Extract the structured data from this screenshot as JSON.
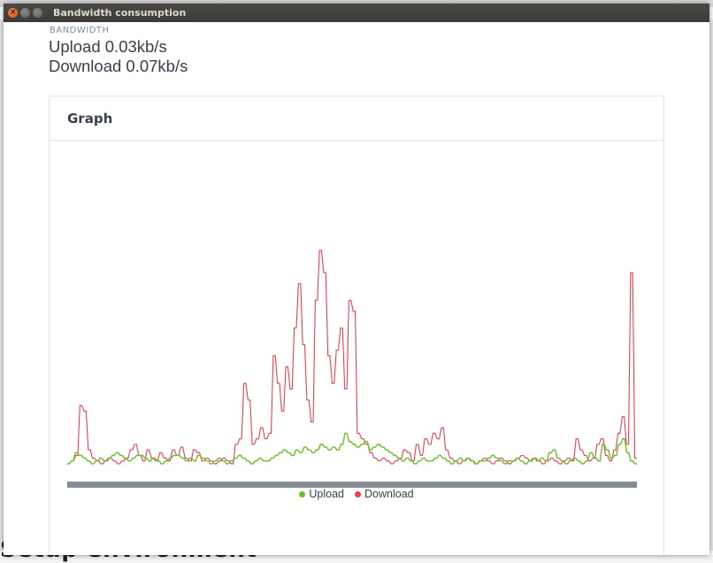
{
  "window": {
    "title": "Bandwidth consumption"
  },
  "header": {
    "kicker": "BANDWIDTH",
    "upload_text": "Upload 0.03kb/s",
    "download_text": "Download 0.07kb/s"
  },
  "card": {
    "title": "Graph"
  },
  "background": {
    "partial_heading": "Setup environment"
  },
  "chart_data": {
    "type": "line",
    "title": "",
    "xlabel": "",
    "ylabel": "",
    "ylim": [
      0,
      100
    ],
    "grid": false,
    "legend_position": "bottom",
    "series": [
      {
        "name": "Upload",
        "color": "#6abf2a",
        "values": [
          1,
          1,
          2,
          2,
          5,
          5,
          4,
          4,
          3,
          3,
          2,
          2,
          1,
          1,
          2,
          2,
          3,
          3,
          2,
          2,
          3,
          3,
          4,
          4,
          5,
          5,
          4,
          4,
          3,
          3,
          2,
          2,
          3,
          3,
          4,
          4,
          4,
          4,
          3,
          3,
          2,
          2,
          3,
          3,
          2,
          2,
          1,
          1,
          2,
          2,
          3,
          3,
          4,
          4,
          4,
          4,
          3,
          3,
          2,
          2,
          3,
          3,
          2,
          2,
          4,
          4,
          3,
          3,
          2,
          2,
          1,
          1,
          2,
          2,
          3,
          3,
          2,
          2,
          1,
          1,
          2,
          2,
          3,
          3,
          4,
          4,
          3,
          3,
          2,
          2,
          1,
          1,
          2,
          2,
          3,
          3,
          2,
          2,
          2,
          2,
          3,
          3,
          4,
          4,
          5,
          5,
          6,
          6,
          5,
          5,
          4,
          4,
          6,
          6,
          5,
          5,
          7,
          7,
          6,
          6,
          5,
          5,
          6,
          6,
          8,
          8,
          7,
          7,
          6,
          6,
          7,
          7,
          6,
          6,
          8,
          8,
          12,
          12,
          9,
          9,
          8,
          8,
          7,
          7,
          8,
          8,
          9,
          9,
          6,
          6,
          7,
          7,
          8,
          8,
          7,
          7,
          6,
          6,
          5,
          5,
          4,
          4,
          3,
          3,
          2,
          2,
          3,
          3,
          2,
          2,
          1,
          1,
          2,
          2,
          3,
          3,
          2,
          2,
          2,
          2,
          3,
          3,
          4,
          4,
          3,
          3,
          2,
          2,
          1,
          1,
          2,
          2,
          3,
          3,
          2,
          2,
          3,
          3,
          2,
          2,
          1,
          1,
          2,
          2,
          2,
          2,
          3,
          3,
          4,
          4,
          3,
          3,
          2,
          2,
          1,
          1,
          2,
          2,
          2,
          2,
          3,
          3,
          2,
          2,
          1,
          1,
          2,
          2,
          3,
          3,
          2,
          2,
          3,
          3,
          2,
          2,
          5,
          5,
          6,
          6,
          3,
          3,
          2,
          2,
          1,
          1,
          2,
          2,
          3,
          3,
          2,
          2,
          1,
          1,
          2,
          2,
          5,
          5,
          3,
          3,
          2,
          2,
          8,
          8,
          6,
          6,
          3,
          3,
          4,
          4,
          8,
          8,
          10,
          10,
          5,
          5,
          2,
          2,
          1,
          1
        ]
      },
      {
        "name": "Download",
        "color": "#e8414f",
        "values": [
          1,
          1,
          2,
          2,
          4,
          4,
          22,
          22,
          20,
          20,
          6,
          6,
          3,
          3,
          2,
          2,
          1,
          1,
          2,
          2,
          3,
          3,
          2,
          2,
          1,
          1,
          2,
          2,
          3,
          3,
          6,
          6,
          8,
          8,
          4,
          4,
          2,
          2,
          6,
          6,
          3,
          3,
          2,
          2,
          5,
          5,
          3,
          3,
          2,
          2,
          6,
          6,
          4,
          4,
          7,
          7,
          3,
          3,
          2,
          2,
          6,
          6,
          5,
          5,
          2,
          2,
          3,
          3,
          2,
          2,
          1,
          1,
          2,
          2,
          3,
          3,
          2,
          2,
          1,
          1,
          8,
          8,
          10,
          10,
          30,
          30,
          24,
          24,
          8,
          8,
          10,
          10,
          14,
          14,
          10,
          10,
          12,
          12,
          40,
          40,
          30,
          30,
          20,
          20,
          36,
          36,
          28,
          28,
          50,
          50,
          66,
          66,
          44,
          44,
          24,
          24,
          16,
          16,
          60,
          60,
          78,
          78,
          70,
          70,
          40,
          40,
          30,
          30,
          42,
          42,
          50,
          50,
          28,
          28,
          60,
          60,
          56,
          56,
          12,
          12,
          10,
          10,
          8,
          8,
          5,
          5,
          3,
          3,
          2,
          2,
          3,
          3,
          2,
          2,
          1,
          1,
          2,
          2,
          3,
          3,
          6,
          6,
          5,
          5,
          2,
          2,
          8,
          8,
          4,
          4,
          10,
          10,
          8,
          8,
          12,
          12,
          10,
          10,
          14,
          14,
          6,
          6,
          3,
          3,
          2,
          2,
          1,
          1,
          2,
          2,
          3,
          3,
          2,
          2,
          1,
          1,
          2,
          2,
          3,
          3,
          2,
          2,
          1,
          1,
          2,
          2,
          3,
          3,
          2,
          2,
          1,
          1,
          2,
          2,
          3,
          3,
          4,
          4,
          3,
          3,
          2,
          2,
          3,
          3,
          2,
          2,
          1,
          1,
          2,
          2,
          3,
          3,
          2,
          2,
          1,
          1,
          2,
          2,
          3,
          3,
          2,
          2,
          10,
          10,
          6,
          6,
          4,
          4,
          2,
          2,
          3,
          3,
          8,
          8,
          10,
          10,
          4,
          4,
          2,
          2,
          6,
          6,
          12,
          12,
          18,
          18,
          8,
          8,
          70,
          70,
          3,
          3
        ]
      }
    ]
  }
}
